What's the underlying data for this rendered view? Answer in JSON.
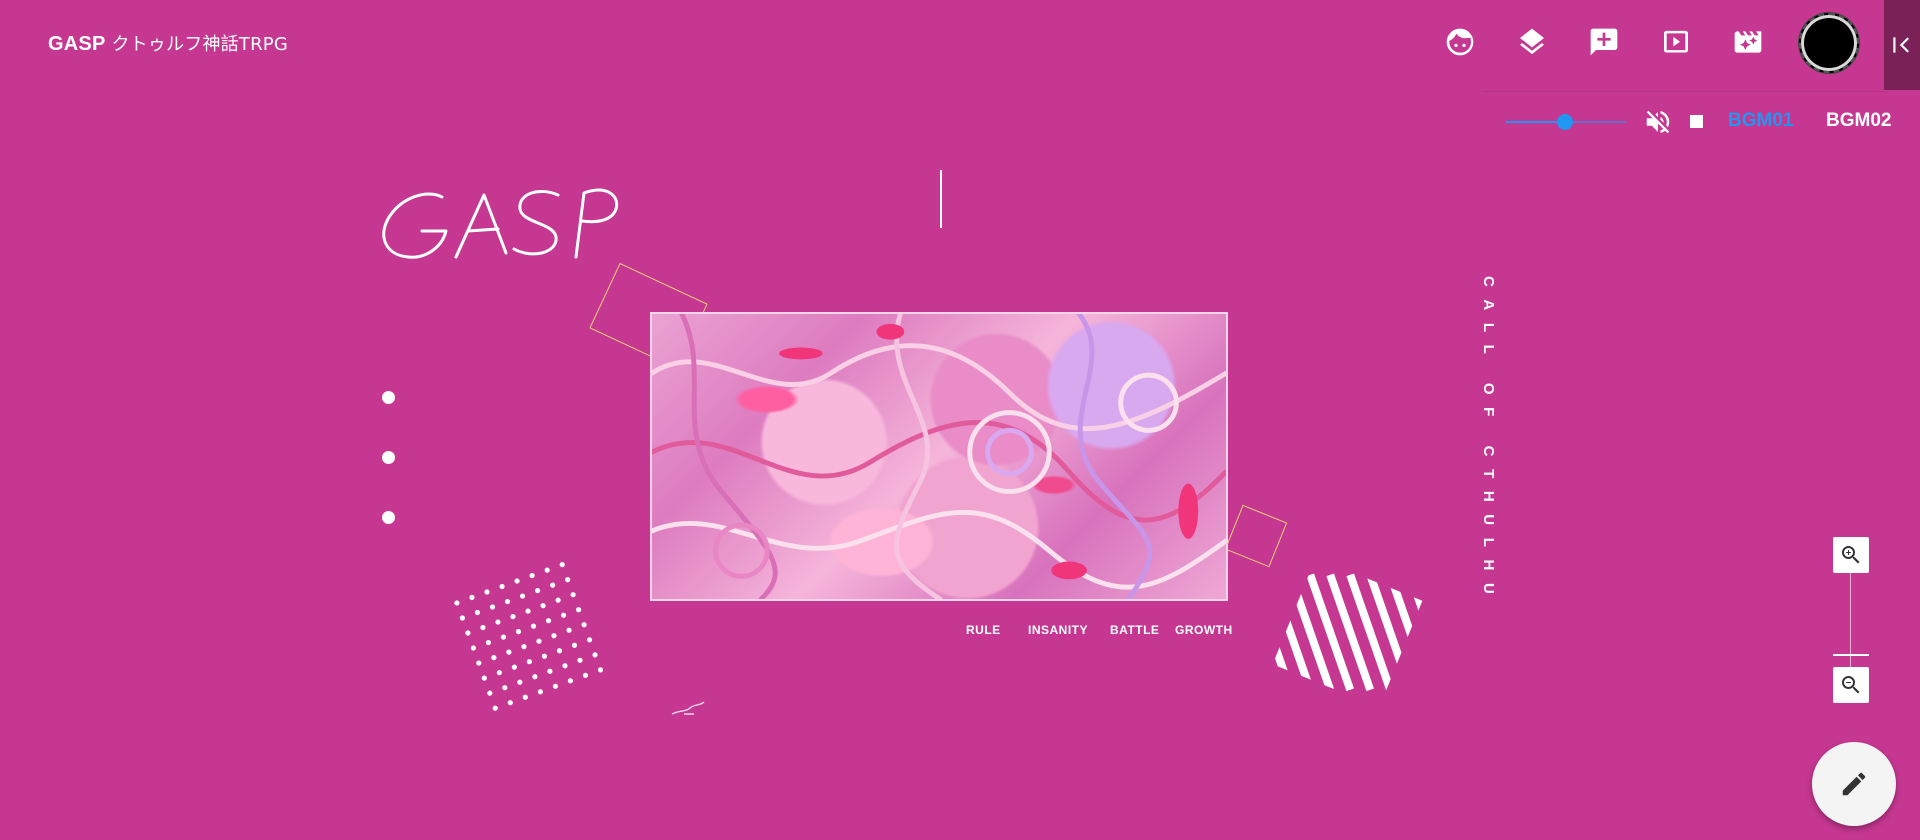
{
  "app": {
    "title_brand": "GASP",
    "title_rest": "クトゥルフ神話TRPG"
  },
  "toolbar": {
    "icons": [
      "face-icon",
      "layers-icon",
      "add-comment-icon",
      "slideshow-icon",
      "movie-effects-icon"
    ],
    "collapse_icon": "collapse-left-icon"
  },
  "audio": {
    "volume_percent": 50,
    "bgm_tracks": [
      "BGM01",
      "BGM02"
    ],
    "active_track": "BGM01",
    "active_color": "#2196f3"
  },
  "scene": {
    "logo_text": "GASP",
    "menu": [
      "RULE",
      "INSANITY",
      "BATTLE",
      "GROWTH"
    ],
    "vertical_caption": "CALL OF CTHULHU",
    "nav_dots": 3
  },
  "colors": {
    "background": "#c53790",
    "deco_outline": "#e8d07a"
  }
}
